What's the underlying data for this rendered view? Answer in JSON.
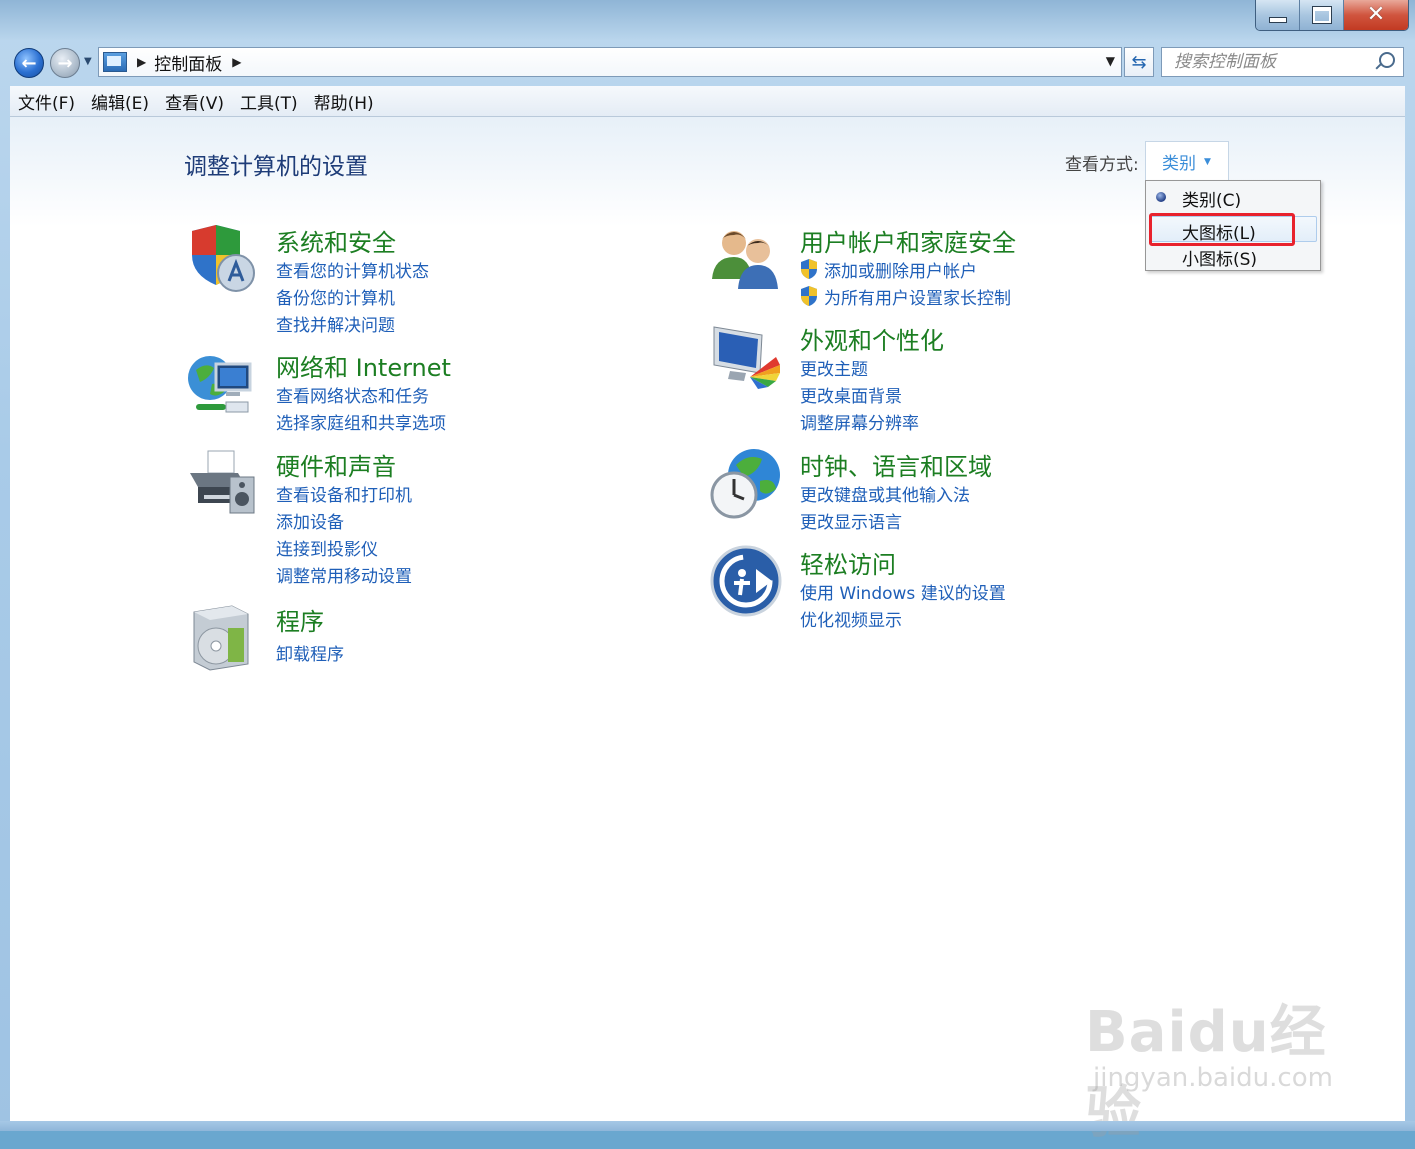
{
  "window": {
    "title_controls": {
      "minimize": "minimize",
      "maximize": "maximize",
      "close": "close"
    }
  },
  "nav": {
    "breadcrumb": "控制面板",
    "search_placeholder": "搜索控制面板"
  },
  "menu": {
    "items": [
      "文件(F)",
      "编辑(E)",
      "查看(V)",
      "工具(T)",
      "帮助(H)"
    ]
  },
  "main": {
    "title": "调整计算机的设置",
    "view_label": "查看方式:",
    "view_value": "类别",
    "view_options": [
      "类别(C)",
      "大图标(L)",
      "小图标(S)"
    ],
    "selected_view": "类别(C)",
    "highlighted_option": "大图标(L)"
  },
  "categories": [
    {
      "title": "系统和安全",
      "icon": "shield-security-icon",
      "links": [
        "查看您的计算机状态",
        "备份您的计算机",
        "查找并解决问题"
      ]
    },
    {
      "title": "网络和 Internet",
      "icon": "network-globe-icon",
      "links": [
        "查看网络状态和任务",
        "选择家庭组和共享选项"
      ]
    },
    {
      "title": "硬件和声音",
      "icon": "printer-speaker-icon",
      "links": [
        "查看设备和打印机",
        "添加设备",
        "连接到投影仪",
        "调整常用移动设置"
      ]
    },
    {
      "title": "程序",
      "icon": "programs-disc-icon",
      "links": [
        "卸载程序"
      ]
    },
    {
      "title": "用户帐户和家庭安全",
      "icon": "users-icon",
      "links": [
        "添加或删除用户帐户",
        "为所有用户设置家长控制"
      ]
    },
    {
      "title": "外观和个性化",
      "icon": "monitor-palette-icon",
      "links": [
        "更改主题",
        "更改桌面背景",
        "调整屏幕分辨率"
      ]
    },
    {
      "title": "时钟、语言和区域",
      "icon": "clock-globe-icon",
      "links": [
        "更改键盘或其他输入法",
        "更改显示语言"
      ]
    },
    {
      "title": "轻松访问",
      "icon": "ease-of-access-icon",
      "links": [
        "使用 Windows 建议的设置",
        "优化视频显示"
      ]
    }
  ],
  "watermark": {
    "logo": "Baidu经验",
    "url": "jingyan.baidu.com"
  },
  "colors": {
    "category_title": "#1c7e22",
    "link": "#1f5fb8",
    "page_title": "#1e3c78",
    "highlight": "#e8222d"
  }
}
